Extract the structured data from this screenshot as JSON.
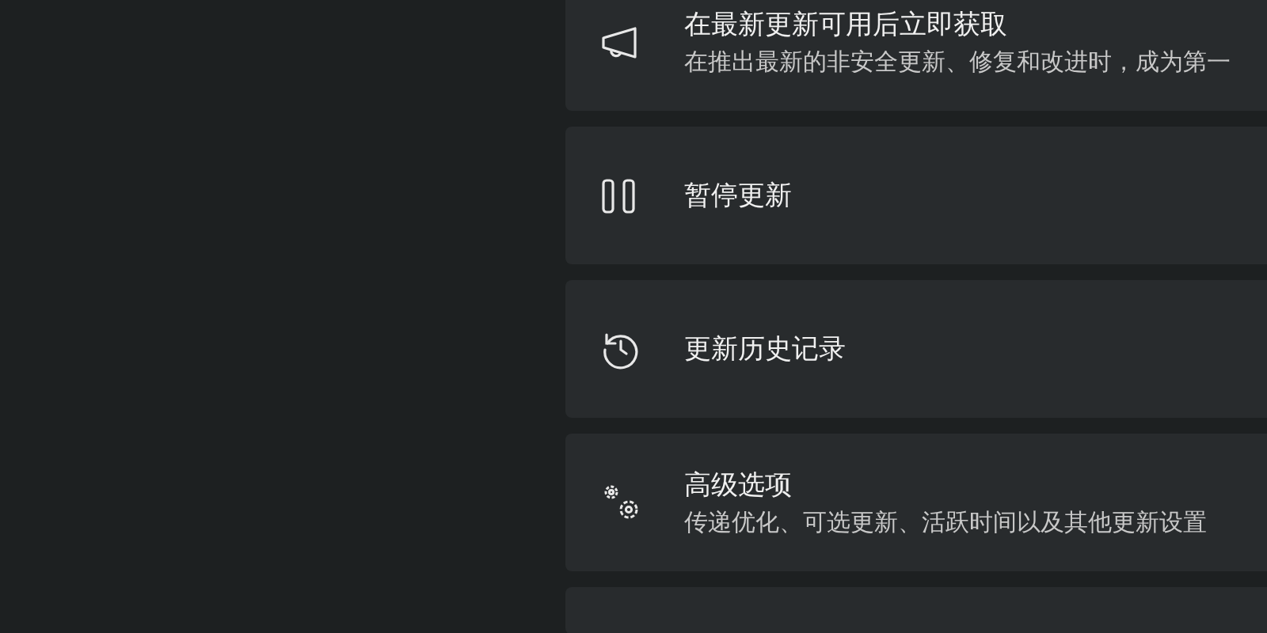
{
  "update_options": [
    {
      "title": "在最新更新可用后立即获取",
      "description": "在推出最新的非安全更新、修复和改进时，成为第一"
    },
    {
      "title": "暂停更新"
    },
    {
      "title": "更新历史记录"
    },
    {
      "title": "高级选项",
      "description": "传递优化、可选更新、活跃时间以及其他更新设置"
    },
    {
      "kind": "cut_off"
    }
  ]
}
